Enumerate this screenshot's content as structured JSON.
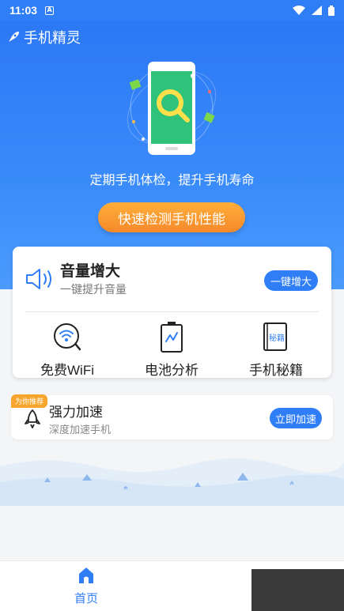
{
  "status_bar": {
    "time": "11:03",
    "notification_icon": "A"
  },
  "app": {
    "title": "手机精灵"
  },
  "hero": {
    "slogan": "定期手机体检，提升手机寿命",
    "scan_button": "快速检测手机性能"
  },
  "volume": {
    "title": "音量增大",
    "subtitle": "一键提升音量",
    "button": "一键增大"
  },
  "tools": [
    {
      "label": "免费WiFi",
      "icon": "wifi-icon"
    },
    {
      "label": "电池分析",
      "icon": "battery-icon"
    },
    {
      "label": "手机秘籍",
      "icon": "book-icon",
      "icon_text": "秘籍"
    }
  ],
  "recommend": {
    "badge": "为你推荐",
    "title": "强力加速",
    "subtitle": "深度加速手机",
    "button": "立即加速"
  },
  "nav": {
    "home": "首页"
  },
  "colors": {
    "primary": "#2f7ef6",
    "orange": "#f6892a",
    "badge": "#f7a52b",
    "phone_screen": "#2ec27a"
  }
}
